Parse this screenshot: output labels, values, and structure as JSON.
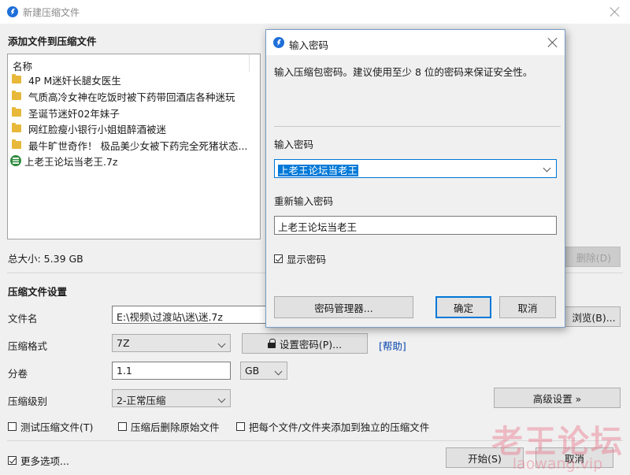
{
  "main_window": {
    "title": "新建压缩文件",
    "add_files_heading": "添加文件到压缩文件",
    "file_list": {
      "column_name": "名称",
      "items": [
        {
          "name": "4P M迷奸长腿女医生",
          "icon": "folder-icon"
        },
        {
          "name": "气质高冷女神在吃饭时被下药带回酒店各种迷玩",
          "icon": "folder-icon"
        },
        {
          "name": "圣诞节迷奸02年妹子",
          "icon": "folder-icon"
        },
        {
          "name": "网红脸瘦小银行小姐姐醉酒被迷",
          "icon": "folder-icon"
        },
        {
          "name": "最牛旷世奇作！ 极品美少女被下药完全死猪状态...",
          "icon": "folder-icon"
        },
        {
          "name": "上老王论坛当老王.7z",
          "icon": "archive-icon"
        }
      ]
    },
    "total_size": "总大小: 5.39 GB",
    "delete_button": "删除(D)",
    "settings_heading": "压缩文件设置",
    "filename_label": "文件名",
    "filename_value": "E:\\视频\\过渡站\\迷\\迷.7z",
    "browse_button": "浏览(B)...",
    "format_label": "压缩格式",
    "format_value": "7Z",
    "set_password_button": "设置密码(P)...",
    "help_link": "[帮助]",
    "volume_label": "分卷",
    "volume_value": "1.1",
    "volume_unit": "GB",
    "level_label": "压缩级别",
    "level_value": "2-正常压缩",
    "advanced_button": "高级设置 »",
    "test_archive": "测试压缩文件(T)",
    "delete_after": "压缩后删除原始文件",
    "each_separate": "把每个文件/文件夹添加到独立的压缩文件",
    "more_options": "更多选项...",
    "start_button": "开始(S)",
    "cancel_button": "取消"
  },
  "password_dialog": {
    "title": "输入密码",
    "description": "输入压缩包密码。建议使用至少 8 位的密码来保证安全性。",
    "password_label": "输入密码",
    "password_value": "上老王论坛当老王",
    "reenter_label": "重新输入密码",
    "reenter_value": "上老王论坛当老王",
    "show_password": "显示密码",
    "password_manager_button": "密码管理器...",
    "ok_button": "确定",
    "cancel_button": "取消"
  },
  "watermark": {
    "cn": "老王论坛",
    "en": "laowang.vip"
  }
}
